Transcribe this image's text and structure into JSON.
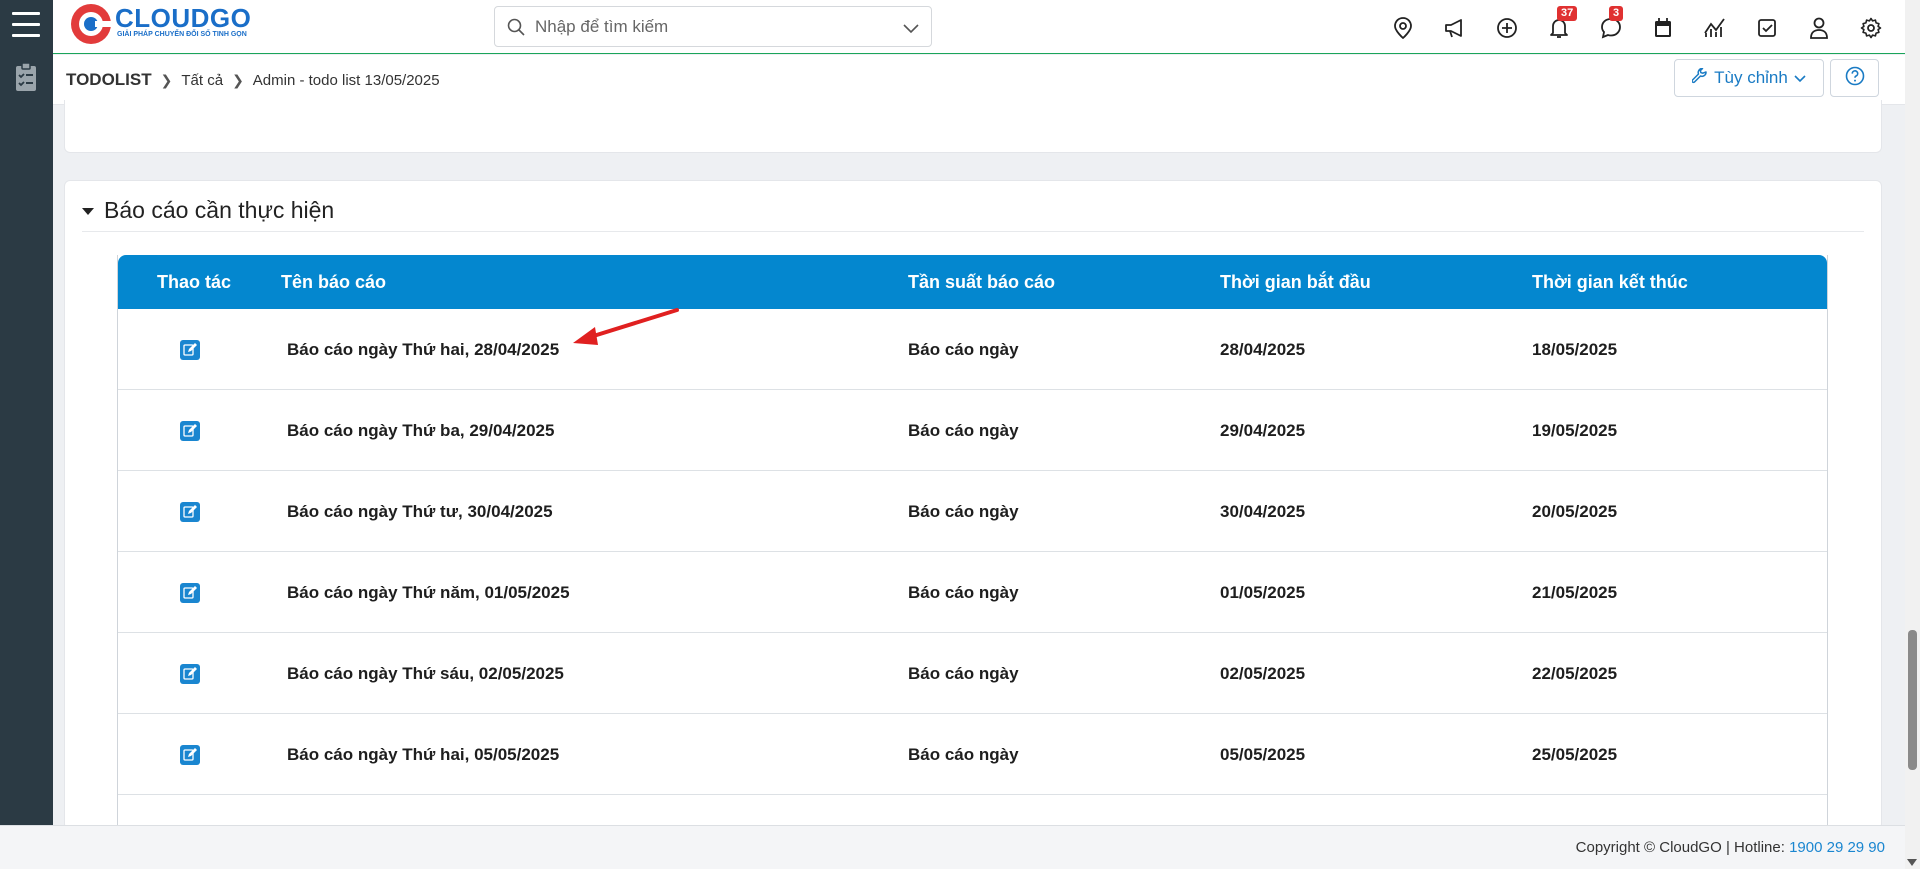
{
  "brand": {
    "name": "CLOUDGO",
    "tagline": "GIẢI PHÁP CHUYỂN ĐỔI SỐ TINH GỌN",
    "color": "#1a6ec8"
  },
  "search": {
    "placeholder": "Nhập để tìm kiếm"
  },
  "header_icons": [
    {
      "name": "location-icon"
    },
    {
      "name": "megaphone-icon"
    },
    {
      "name": "add-circle-icon"
    },
    {
      "name": "bell-icon",
      "badge": "37"
    },
    {
      "name": "chat-icon",
      "badge": "3"
    },
    {
      "name": "calendar-icon"
    },
    {
      "name": "analytics-icon"
    },
    {
      "name": "checkbox-icon"
    },
    {
      "name": "user-icon"
    },
    {
      "name": "settings-icon"
    }
  ],
  "breadcrumb": {
    "root": "TODOLIST",
    "level1": "Tất cả",
    "level2": "Admin - todo list 13/05/2025"
  },
  "toolbar": {
    "customize_label": "Tùy chỉnh"
  },
  "section": {
    "title": "Báo cáo cần thực hiện"
  },
  "table": {
    "columns": [
      "Thao tác",
      "Tên báo cáo",
      "Tần suất báo cáo",
      "Thời gian bắt đầu",
      "Thời gian kết thúc"
    ],
    "rows": [
      {
        "name": "Báo cáo ngày Thứ hai, 28/04/2025",
        "freq": "Báo cáo ngày",
        "start": "28/04/2025",
        "end": "18/05/2025"
      },
      {
        "name": "Báo cáo ngày Thứ ba, 29/04/2025",
        "freq": "Báo cáo ngày",
        "start": "29/04/2025",
        "end": "19/05/2025"
      },
      {
        "name": "Báo cáo ngày Thứ tư, 30/04/2025",
        "freq": "Báo cáo ngày",
        "start": "30/04/2025",
        "end": "20/05/2025"
      },
      {
        "name": "Báo cáo ngày Thứ năm, 01/05/2025",
        "freq": "Báo cáo ngày",
        "start": "01/05/2025",
        "end": "21/05/2025"
      },
      {
        "name": "Báo cáo ngày Thứ sáu, 02/05/2025",
        "freq": "Báo cáo ngày",
        "start": "02/05/2025",
        "end": "22/05/2025"
      },
      {
        "name": "Báo cáo ngày Thứ hai, 05/05/2025",
        "freq": "Báo cáo ngày",
        "start": "05/05/2025",
        "end": "25/05/2025"
      }
    ]
  },
  "footer": {
    "copyright": "Copyright © CloudGO",
    "hotline_label": "Hotline:",
    "hotline": "1900 29 29 90"
  },
  "colors": {
    "header_table": "#0487cf",
    "accent": "#1a86d0",
    "sidebar": "#2b3a44",
    "annotation_arrow": "#e02020"
  }
}
